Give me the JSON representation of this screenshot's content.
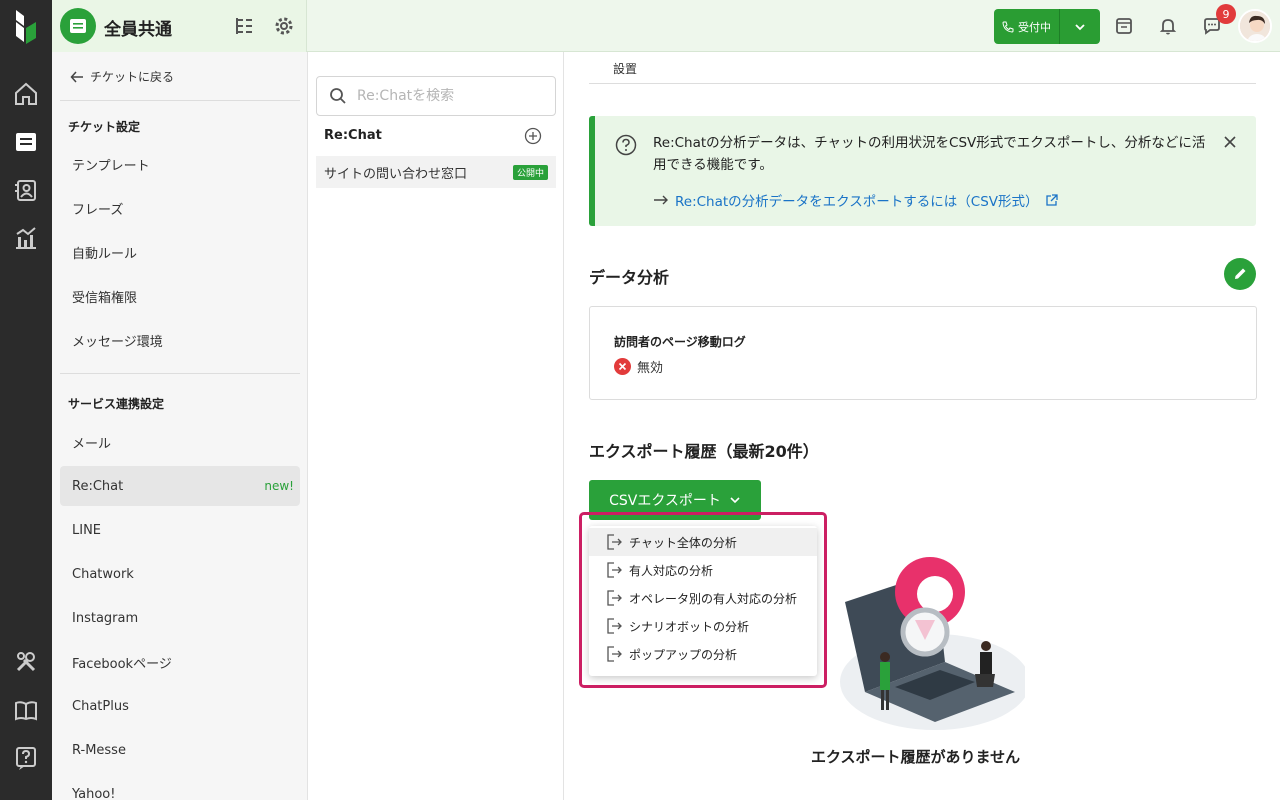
{
  "rail": {
    "items": [
      "home-icon",
      "ticket-icon",
      "contacts-icon",
      "analytics-icon",
      "tools-icon",
      "manual-icon",
      "help-icon"
    ]
  },
  "topbar": {
    "title": "全員共通",
    "status_label": "受付中",
    "notification_count": "9"
  },
  "settings": {
    "back_label": "チケットに戻る",
    "section1_title": "チケット設定",
    "section1_items": [
      "テンプレート",
      "フレーズ",
      "自動ルール",
      "受信箱権限",
      "メッセージ環境"
    ],
    "section2_title": "サービス連携設定",
    "section2_items": [
      "メール",
      "Re:Chat",
      "LINE",
      "Chatwork",
      "Instagram",
      "Facebookページ",
      "ChatPlus",
      "R-Messe",
      "Yahoo!"
    ],
    "new_badge": "new!"
  },
  "channels": {
    "search_placeholder": "Re:Chatを検索",
    "header": "Re:Chat",
    "item_name": "サイトの問い合わせ窓口",
    "item_status": "公開中"
  },
  "main": {
    "tab_label": "設置",
    "info_text": "Re:Chatの分析データは、チャットの利用状況をCSV形式でエクスポートし、分析などに活用できる機能です。",
    "info_link": "Re:Chatの分析データをエクスポートするには（CSV形式）",
    "data_section_title": "データ分析",
    "card_label": "訪問者のページ移動ログ",
    "card_value": "無効",
    "export_section_title": "エクスポート履歴（最新20件）",
    "csv_button": "CSVエクスポート",
    "menu_items": [
      "チャット全体の分析",
      "有人対応の分析",
      "オペレータ別の有人対応の分析",
      "シナリオボットの分析",
      "ポップアップの分析"
    ],
    "empty_text": "エクスポート履歴がありません"
  },
  "colors": {
    "accent": "#2aa13a",
    "highlight": "#cc1f63",
    "link": "#1a73c7",
    "danger": "#e23b3b"
  }
}
